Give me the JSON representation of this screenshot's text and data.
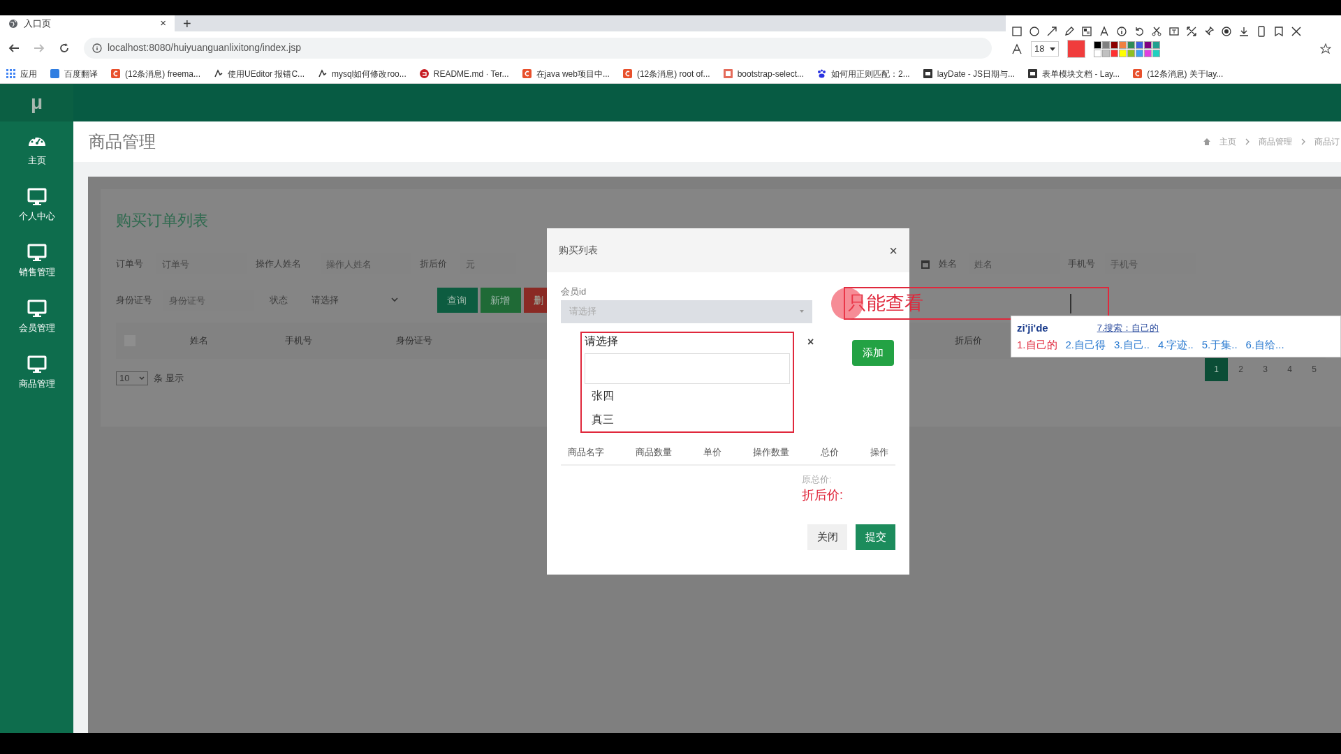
{
  "browser": {
    "tab": {
      "title": "入口页",
      "close": "×"
    },
    "new_tab": "+",
    "url": "localhost:8080/huiyuanguanlixitong/index.jsp",
    "bookmarks": [
      "应用",
      "百度翻译",
      "(12条消息) freema...",
      "使用UEditor 报错C...",
      "mysql如何修改roo...",
      "README.md · Ter...",
      "在java web项目中...",
      "(12条消息) root of...",
      "bootstrap-select...",
      "如何用正则匹配：2...",
      "layDate - JS日期与...",
      "表单模块文档 - Lay...",
      "(12条消息) 关于lay..."
    ]
  },
  "annotation_toolbar": {
    "font_size": "18"
  },
  "app": {
    "logo": "μ",
    "sidebar": [
      "主页",
      "个人中心",
      "销售管理",
      "会员管理",
      "商品管理"
    ],
    "page_title": "商品管理",
    "breadcrumb": [
      "主页",
      "商品管理",
      "商品订"
    ],
    "panel": {
      "title": "购买订单列表",
      "filters_row1": [
        {
          "label": "订单号",
          "placeholder": "订单号"
        },
        {
          "label": "操作人姓名",
          "placeholder": "操作人姓名"
        },
        {
          "label": "折后价",
          "placeholder": "元"
        }
      ],
      "filters_right": [
        {
          "label": "姓名",
          "placeholder": "姓名"
        },
        {
          "label": "手机号",
          "placeholder": "手机号"
        }
      ],
      "filters_row2": [
        {
          "label": "身份证号",
          "placeholder": "身份证号"
        },
        {
          "label": "状态",
          "placeholder": "请选择"
        }
      ],
      "buttons": [
        {
          "label": "查询",
          "kind": "primary"
        },
        {
          "label": "新增",
          "kind": "success"
        },
        {
          "label": "删",
          "kind": "danger"
        }
      ],
      "select_all_checked": false,
      "columns": [
        "姓名",
        "手机号",
        "身份证号",
        "折后价"
      ],
      "page_size": "10",
      "page_size_suffix": "条 显示",
      "pages": [
        {
          "label": "1",
          "selected": true
        },
        {
          "label": "2",
          "selected": false
        },
        {
          "label": "3",
          "selected": false
        },
        {
          "label": "4",
          "selected": false
        },
        {
          "label": "5",
          "selected": false
        }
      ]
    }
  },
  "modal": {
    "title": "购买列表",
    "close": "×",
    "member_label": "会员id",
    "member_placeholder": "请选择",
    "dropdown": {
      "header": "请选择",
      "clear": "×",
      "options": [
        "张四",
        "真三"
      ]
    },
    "add_button": "添加",
    "columns": [
      "商品名字",
      "商品数量",
      "单价",
      "操作数量",
      "总价",
      "操作"
    ],
    "original_total": "原总价:",
    "discount_price": "折后价:",
    "close_button": "关闭",
    "submit_button": "提交"
  },
  "note": {
    "text": "只能查看"
  },
  "ime": {
    "input": "zi'ji'de",
    "search": "7.搜索：自己的",
    "candidates": [
      "1.自己的",
      "2.自己得",
      "3.自己..",
      "4.字迹..",
      "5.于集..",
      "6.自给..."
    ]
  }
}
